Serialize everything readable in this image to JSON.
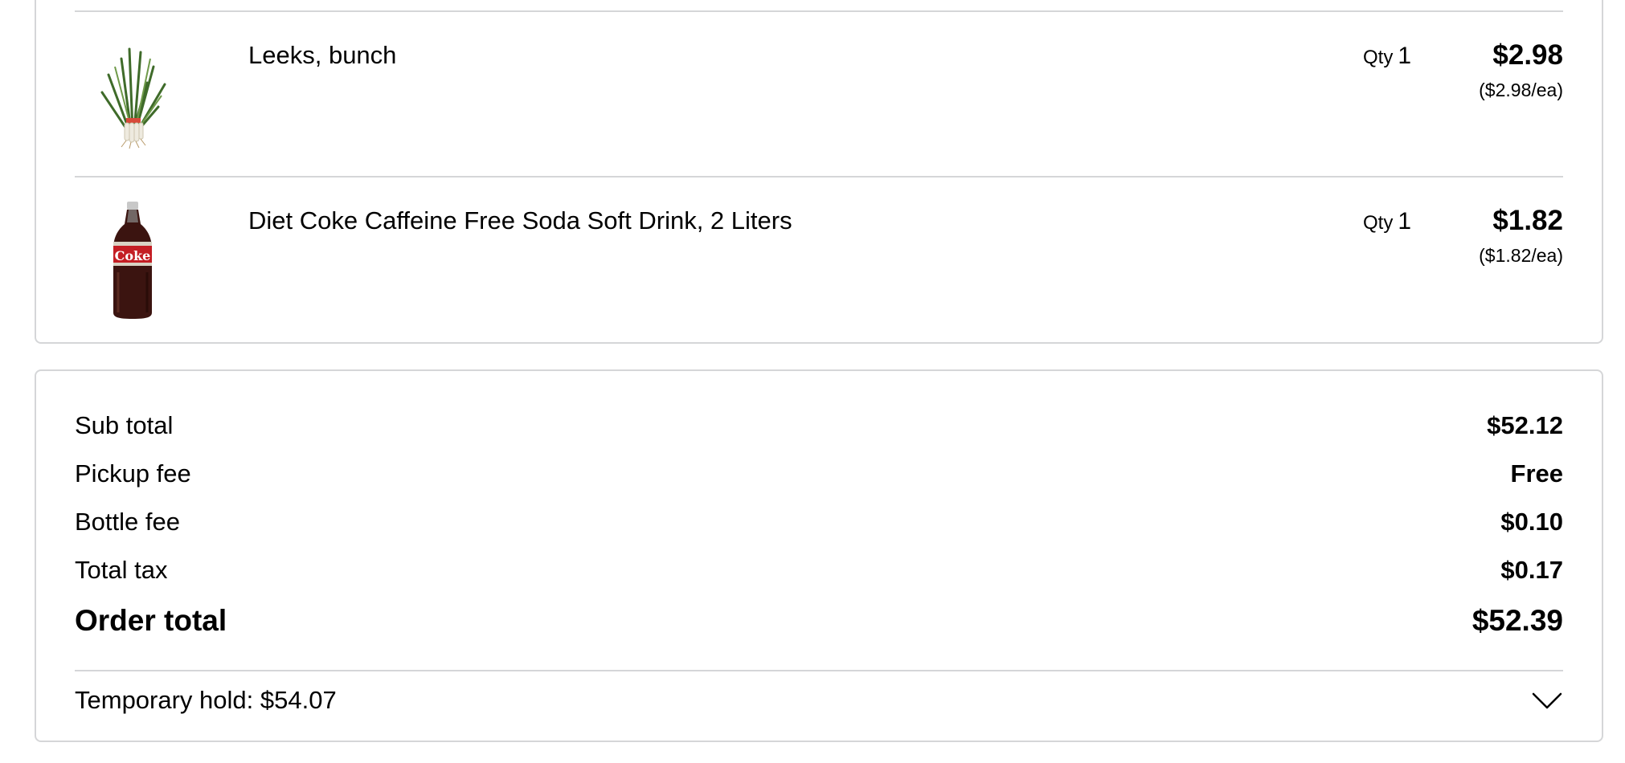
{
  "items": [
    {
      "name": "Leeks, bunch",
      "qty_label": "Qty",
      "qty": "1",
      "price": "$2.98",
      "unit_price": "($2.98/ea)",
      "image": "leeks-image"
    },
    {
      "name": "Diet Coke Caffeine Free Soda Soft Drink, 2 Liters",
      "qty_label": "Qty",
      "qty": "1",
      "price": "$1.82",
      "unit_price": "($1.82/ea)",
      "image": "diet-coke-bottle-image",
      "bottle_label": "Coke"
    }
  ],
  "summary": {
    "subtotal_label": "Sub total",
    "subtotal": "$52.12",
    "pickup_label": "Pickup fee",
    "pickup": "Free",
    "bottle_label": "Bottle fee",
    "bottle": "$0.10",
    "tax_label": "Total tax",
    "tax": "$0.17",
    "total_label": "Order total",
    "total": "$52.39",
    "hold_label": "Temporary hold: $54.07",
    "hold_icon": "chevron-down-icon"
  },
  "colors": {
    "border": "#d5d6d8",
    "text": "#000000",
    "background": "#ffffff"
  }
}
